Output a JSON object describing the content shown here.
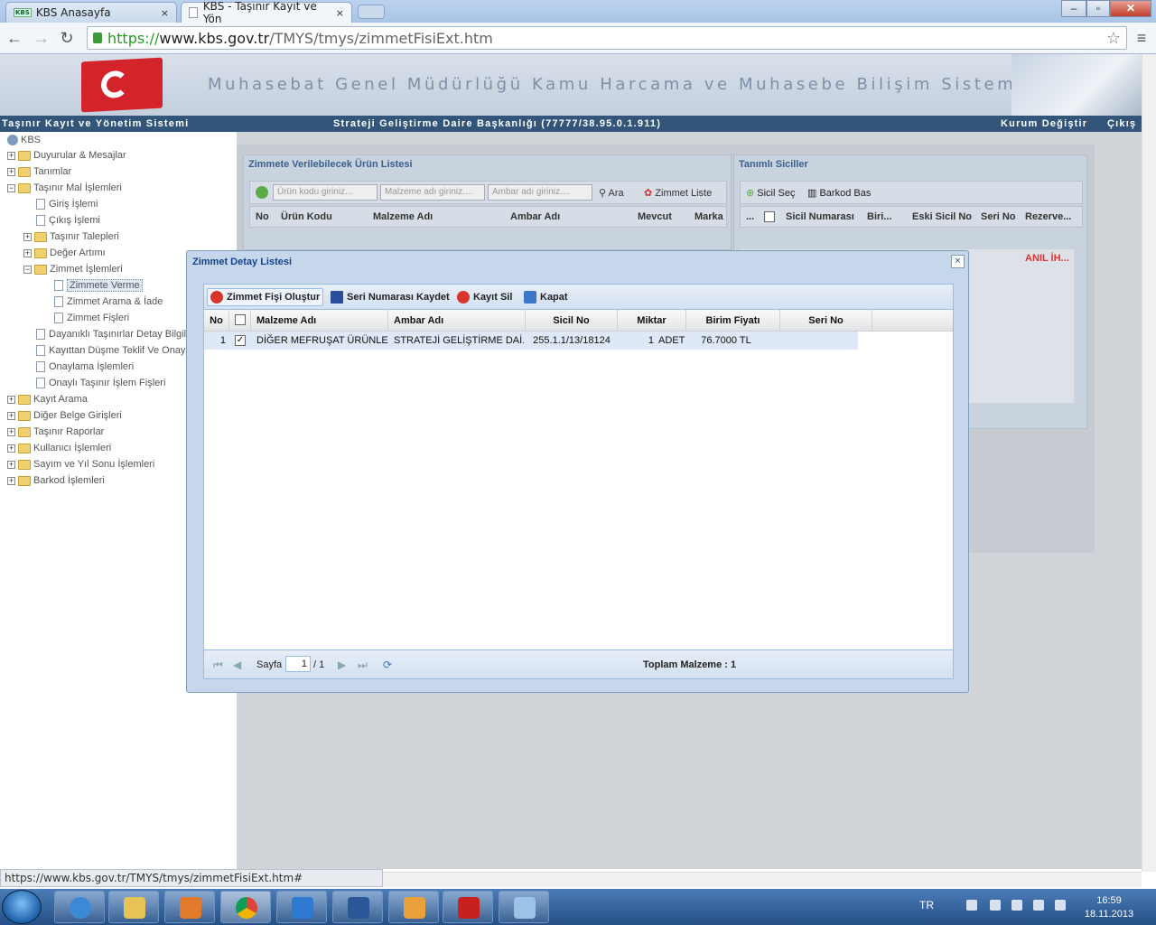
{
  "browser": {
    "tabs": [
      {
        "title": "KBS Anasayfa",
        "favicon": "KBS"
      },
      {
        "title": "KBS - Taşınır Kayıt ve Yön"
      }
    ],
    "close_glyph": "×",
    "url": {
      "scheme": "https://",
      "host": "www.kbs.gov.tr",
      "path": "/TMYS/tmys/zimmetFisiExt.htm"
    },
    "status_url": "https://www.kbs.gov.tr/TMYS/tmys/zimmetFisiExt.htm#"
  },
  "header": {
    "title": "Muhasebat Genel Müdürlüğü Kamu Harcama ve Muhasebe Bilişim Sistemi",
    "app_name": "Taşınır Kayıt ve Yönetim Sistemi",
    "unit": "Strateji Geliştirme Daire Başkanlığı (77777/38.95.0.1.911)",
    "change_org": "Kurum Değiştir",
    "logout": "Çıkış"
  },
  "sidebar": {
    "root": "KBS",
    "items": [
      {
        "label": "Duyurular & Mesajlar"
      },
      {
        "label": "Tanımlar"
      },
      {
        "label": "Taşınır Mal İşlemleri"
      },
      {
        "label": "Giriş İşlemi"
      },
      {
        "label": "Çıkış İşlemi"
      },
      {
        "label": "Taşınır Talepleri"
      },
      {
        "label": "Değer Artımı"
      },
      {
        "label": "Zimmet İşlemleri"
      },
      {
        "label": "Zimmete Verme"
      },
      {
        "label": "Zimmet Arama & İade"
      },
      {
        "label": "Zimmet Fişleri"
      },
      {
        "label": "Dayanıklı Taşınırlar Detay Bilgile"
      },
      {
        "label": "Kayıttan Düşme Teklif Ve Onay"
      },
      {
        "label": "Onaylama İşlemleri"
      },
      {
        "label": "Onaylı Taşınır İşlem Fişleri"
      },
      {
        "label": "Kayıt Arama"
      },
      {
        "label": "Diğer Belge Girişleri"
      },
      {
        "label": "Taşınır Raporlar"
      },
      {
        "label": "Kullanıcı İşlemleri"
      },
      {
        "label": "Sayım ve Yıl Sonu İşlemleri"
      },
      {
        "label": "Barkod İşlemleri"
      }
    ]
  },
  "product_panel": {
    "title": "Zimmete Verilebilecek Ürün Listesi",
    "filters": [
      "Ürün kodu giriniz...",
      "Malzeme adı giriniz....",
      "Ambar adı giriniz...."
    ],
    "search_label": "Ara",
    "list_label": "Zimmet Liste",
    "columns": [
      "No",
      "Ürün Kodu",
      "Malzeme Adı",
      "Ambar Adı",
      "Mevcut",
      "Marka"
    ]
  },
  "registry_panel": {
    "title": "Tanımlı Siciller",
    "select_label": "Sicil Seç",
    "barcode_label": "Barkod Bas",
    "columns": [
      "...",
      "Sicil Numarası",
      "Biri...",
      "Eski Sicil No",
      "Seri No",
      "Rezerve..."
    ],
    "row_flag": "ANIL İH..."
  },
  "modal": {
    "title": "Zimmet Detay Listesi",
    "close": "×",
    "buttons": {
      "create": "Zimmet Fişi Oluştur",
      "save_serial": "Seri Numarası Kaydet",
      "delete": "Kayıt Sil",
      "close": "Kapat"
    },
    "columns": [
      "No",
      "Malzeme Adı",
      "Ambar Adı",
      "Sicil No",
      "Miktar",
      "Birim Fiyatı",
      "Seri No"
    ],
    "rows": [
      {
        "no": "1",
        "checked": "✓",
        "material": "DİĞER MEFRUŞAT ÜRÜNLERİ",
        "warehouse": "STRATEJİ GELİŞTİRME DAİ...",
        "registry": "255.1.1/13/18124",
        "qty": "1",
        "unit": "ADET",
        "price": "76.7000 TL",
        "serial": ""
      }
    ],
    "pager": {
      "page_label": "Sayfa",
      "page": "1",
      "of": "/ 1",
      "total": "Toplam Malzeme : 1"
    }
  },
  "taskbar": {
    "lang": "TR",
    "time": "16:59",
    "date": "18.11.2013"
  }
}
